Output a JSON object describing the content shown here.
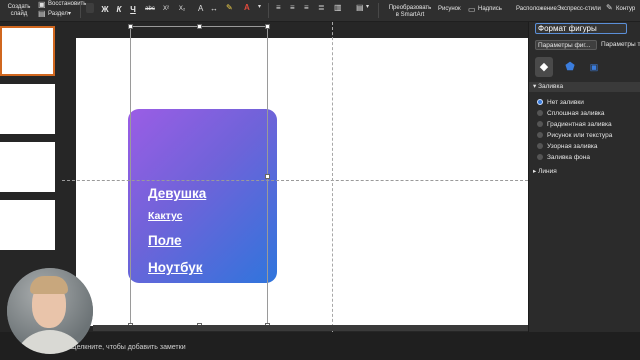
{
  "ribbon": {
    "new_slide": "Создать\nслайд",
    "restore": "Восстановить",
    "section": "Раздел",
    "bold": "Ж",
    "italic": "К",
    "underline": "Ч",
    "strike": "abc",
    "superscript": "X²",
    "subscript": "X₂",
    "convert_smartart": "Преобразовать\nв SmartArt",
    "picture": "Рисунок",
    "textbox": "Надпись",
    "arrange": "Расположение",
    "quick_styles": "Экспресс-стили",
    "outline": "Контур"
  },
  "slide": {
    "items": [
      "Девушка",
      "Кактус",
      "Поле",
      "Ноутбук"
    ]
  },
  "notes_placeholder": "Щелкните, чтобы добавить заметки",
  "pane": {
    "title": "Формат фигуры",
    "tab_shape": "Параметры фиг...",
    "tab_text": "Параметры т",
    "fill_section": "Заливка",
    "fill_options": [
      "Нет заливки",
      "Сплошная заливка",
      "Градиентная заливка",
      "Рисунок или текстура",
      "Узорная заливка",
      "Заливка фона"
    ],
    "selected_fill": "Нет заливки",
    "line_section": "Линия"
  },
  "colors": {
    "accent": "#3b7ddd",
    "gradient_start": "#9b5de5",
    "gradient_end": "#2f75dc",
    "thumb_selected": "#d0671f"
  }
}
